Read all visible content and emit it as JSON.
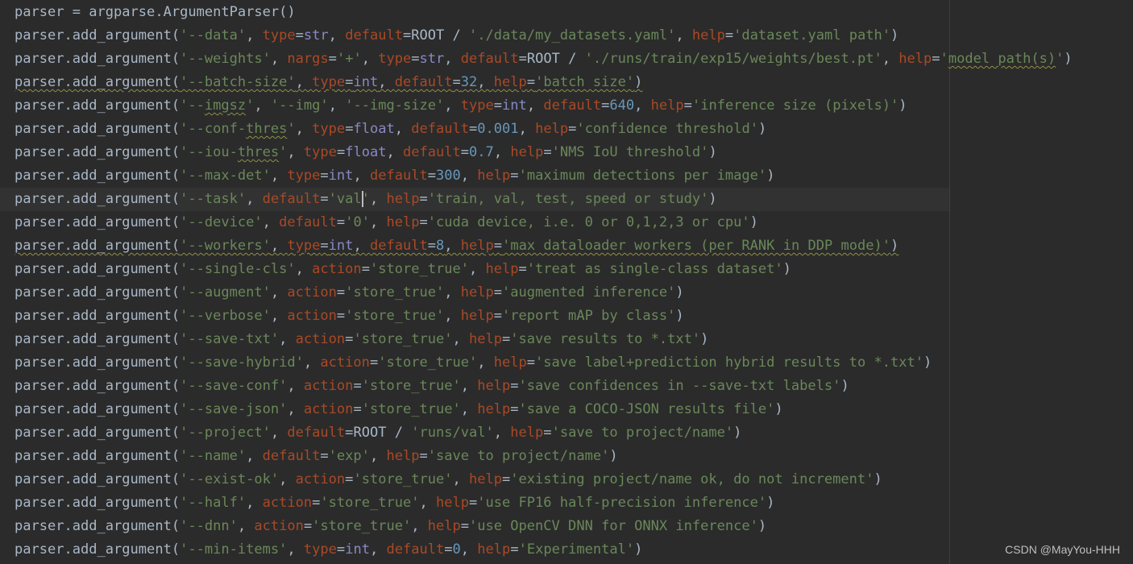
{
  "editor": {
    "caret_line": 8,
    "lines": [
      [
        [
          "id",
          "parser = argparse.ArgumentParser()"
        ]
      ],
      [
        [
          "id",
          "parser.add_argument("
        ],
        [
          "str",
          "'--data'"
        ],
        [
          "op",
          ", "
        ],
        [
          "kw",
          "type"
        ],
        [
          "op",
          "="
        ],
        [
          "builtin",
          "str"
        ],
        [
          "op",
          ", "
        ],
        [
          "kw",
          "default"
        ],
        [
          "op",
          "="
        ],
        [
          "id",
          "ROOT / "
        ],
        [
          "str",
          "'./data/my_datasets.yaml'"
        ],
        [
          "op",
          ", "
        ],
        [
          "kw",
          "help"
        ],
        [
          "op",
          "="
        ],
        [
          "str",
          "'dataset.yaml path'"
        ],
        [
          "op",
          ")"
        ]
      ],
      [
        [
          "id",
          "parser.add_argument("
        ],
        [
          "str",
          "'--weights'"
        ],
        [
          "op",
          ", "
        ],
        [
          "kw",
          "nargs"
        ],
        [
          "op",
          "="
        ],
        [
          "str",
          "'+'"
        ],
        [
          "op",
          ", "
        ],
        [
          "kw",
          "type"
        ],
        [
          "op",
          "="
        ],
        [
          "builtin",
          "str"
        ],
        [
          "op",
          ", "
        ],
        [
          "kw",
          "default"
        ],
        [
          "op",
          "="
        ],
        [
          "id",
          "ROOT / "
        ],
        [
          "str",
          "'./runs/train/exp15/weights/best.pt'"
        ],
        [
          "op",
          ", "
        ],
        [
          "kw",
          "help"
        ],
        [
          "op",
          "="
        ],
        [
          "str",
          "'"
        ],
        [
          "strsq",
          "model path(s)"
        ],
        [
          "str",
          "'"
        ],
        [
          "op",
          ")"
        ]
      ],
      [
        [
          "sq",
          "parser.add_argument("
        ],
        [
          "strsq",
          "'--batch-size'"
        ],
        [
          "opsq",
          ", "
        ],
        [
          "kwsq",
          "type"
        ],
        [
          "opsq",
          "="
        ],
        [
          "builtinsq",
          "int"
        ],
        [
          "opsq",
          ", "
        ],
        [
          "kwsq",
          "default"
        ],
        [
          "opsq",
          "="
        ],
        [
          "numsq",
          "32"
        ],
        [
          "opsq",
          ", "
        ],
        [
          "kwsq",
          "help"
        ],
        [
          "opsq",
          "="
        ],
        [
          "strsq",
          "'batch size'"
        ],
        [
          "opsq",
          ")"
        ]
      ],
      [
        [
          "id",
          "parser.add_argument("
        ],
        [
          "str",
          "'--"
        ],
        [
          "strsq",
          "imgsz"
        ],
        [
          "str",
          "'"
        ],
        [
          "op",
          ", "
        ],
        [
          "str",
          "'--img'"
        ],
        [
          "op",
          ", "
        ],
        [
          "str",
          "'--img-size'"
        ],
        [
          "op",
          ", "
        ],
        [
          "kw",
          "type"
        ],
        [
          "op",
          "="
        ],
        [
          "builtin",
          "int"
        ],
        [
          "op",
          ", "
        ],
        [
          "kw",
          "default"
        ],
        [
          "op",
          "="
        ],
        [
          "num",
          "640"
        ],
        [
          "op",
          ", "
        ],
        [
          "kw",
          "help"
        ],
        [
          "op",
          "="
        ],
        [
          "str",
          "'inference size (pixels)'"
        ],
        [
          "op",
          ")"
        ]
      ],
      [
        [
          "id",
          "parser.add_argument("
        ],
        [
          "str",
          "'--conf-"
        ],
        [
          "strsq",
          "thres"
        ],
        [
          "str",
          "'"
        ],
        [
          "op",
          ", "
        ],
        [
          "kw",
          "type"
        ],
        [
          "op",
          "="
        ],
        [
          "builtin",
          "float"
        ],
        [
          "op",
          ", "
        ],
        [
          "kw",
          "default"
        ],
        [
          "op",
          "="
        ],
        [
          "num",
          "0.001"
        ],
        [
          "op",
          ", "
        ],
        [
          "kw",
          "help"
        ],
        [
          "op",
          "="
        ],
        [
          "str",
          "'confidence threshold'"
        ],
        [
          "op",
          ")"
        ]
      ],
      [
        [
          "id",
          "parser.add_argument("
        ],
        [
          "str",
          "'--iou-"
        ],
        [
          "strsq",
          "thres"
        ],
        [
          "str",
          "'"
        ],
        [
          "op",
          ", "
        ],
        [
          "kw",
          "type"
        ],
        [
          "op",
          "="
        ],
        [
          "builtin",
          "float"
        ],
        [
          "op",
          ", "
        ],
        [
          "kw",
          "default"
        ],
        [
          "op",
          "="
        ],
        [
          "num",
          "0.7"
        ],
        [
          "op",
          ", "
        ],
        [
          "kw",
          "help"
        ],
        [
          "op",
          "="
        ],
        [
          "str",
          "'NMS IoU threshold'"
        ],
        [
          "op",
          ")"
        ]
      ],
      [
        [
          "id",
          "parser.add_argument("
        ],
        [
          "str",
          "'--max-det'"
        ],
        [
          "op",
          ", "
        ],
        [
          "kw",
          "type"
        ],
        [
          "op",
          "="
        ],
        [
          "builtin",
          "int"
        ],
        [
          "op",
          ", "
        ],
        [
          "kw",
          "default"
        ],
        [
          "op",
          "="
        ],
        [
          "num",
          "300"
        ],
        [
          "op",
          ", "
        ],
        [
          "kw",
          "help"
        ],
        [
          "op",
          "="
        ],
        [
          "str",
          "'maximum detections per image'"
        ],
        [
          "op",
          ")"
        ]
      ],
      [
        [
          "id",
          "parser.add_argument("
        ],
        [
          "str",
          "'--task'"
        ],
        [
          "op",
          ", "
        ],
        [
          "kw",
          "default"
        ],
        [
          "op",
          "="
        ],
        [
          "str",
          "'val'"
        ],
        [
          "op",
          ", "
        ],
        [
          "kw",
          "help"
        ],
        [
          "op",
          "="
        ],
        [
          "str",
          "'train, val, test, speed or study'"
        ],
        [
          "op",
          ")"
        ]
      ],
      [
        [
          "id",
          "parser.add_argument("
        ],
        [
          "str",
          "'--device'"
        ],
        [
          "op",
          ", "
        ],
        [
          "kw",
          "default"
        ],
        [
          "op",
          "="
        ],
        [
          "str",
          "'0'"
        ],
        [
          "op",
          ", "
        ],
        [
          "kw",
          "help"
        ],
        [
          "op",
          "="
        ],
        [
          "str",
          "'cuda device, i.e. 0 or 0,1,2,3 or cpu'"
        ],
        [
          "op",
          ")"
        ]
      ],
      [
        [
          "sq",
          "parser.add_argument("
        ],
        [
          "strsq",
          "'--workers'"
        ],
        [
          "opsq",
          ", "
        ],
        [
          "kwsq",
          "type"
        ],
        [
          "opsq",
          "="
        ],
        [
          "builtinsq",
          "int"
        ],
        [
          "opsq",
          ", "
        ],
        [
          "kwsq",
          "default"
        ],
        [
          "opsq",
          "="
        ],
        [
          "numsq",
          "8"
        ],
        [
          "opsq",
          ", "
        ],
        [
          "kwsq",
          "help"
        ],
        [
          "opsq",
          "="
        ],
        [
          "strsq",
          "'max dataloader workers (per RANK in DDP mode)'"
        ],
        [
          "opsq",
          ")"
        ]
      ],
      [
        [
          "id",
          "parser.add_argument("
        ],
        [
          "str",
          "'--single-cls'"
        ],
        [
          "op",
          ", "
        ],
        [
          "kw",
          "action"
        ],
        [
          "op",
          "="
        ],
        [
          "str",
          "'store_true'"
        ],
        [
          "op",
          ", "
        ],
        [
          "kw",
          "help"
        ],
        [
          "op",
          "="
        ],
        [
          "str",
          "'treat as single-class dataset'"
        ],
        [
          "op",
          ")"
        ]
      ],
      [
        [
          "id",
          "parser.add_argument("
        ],
        [
          "str",
          "'--augment'"
        ],
        [
          "op",
          ", "
        ],
        [
          "kw",
          "action"
        ],
        [
          "op",
          "="
        ],
        [
          "str",
          "'store_true'"
        ],
        [
          "op",
          ", "
        ],
        [
          "kw",
          "help"
        ],
        [
          "op",
          "="
        ],
        [
          "str",
          "'augmented inference'"
        ],
        [
          "op",
          ")"
        ]
      ],
      [
        [
          "id",
          "parser.add_argument("
        ],
        [
          "str",
          "'--verbose'"
        ],
        [
          "op",
          ", "
        ],
        [
          "kw",
          "action"
        ],
        [
          "op",
          "="
        ],
        [
          "str",
          "'store_true'"
        ],
        [
          "op",
          ", "
        ],
        [
          "kw",
          "help"
        ],
        [
          "op",
          "="
        ],
        [
          "str",
          "'report mAP by class'"
        ],
        [
          "op",
          ")"
        ]
      ],
      [
        [
          "id",
          "parser.add_argument("
        ],
        [
          "str",
          "'--save-txt'"
        ],
        [
          "op",
          ", "
        ],
        [
          "kw",
          "action"
        ],
        [
          "op",
          "="
        ],
        [
          "str",
          "'store_true'"
        ],
        [
          "op",
          ", "
        ],
        [
          "kw",
          "help"
        ],
        [
          "op",
          "="
        ],
        [
          "str",
          "'save results to *.txt'"
        ],
        [
          "op",
          ")"
        ]
      ],
      [
        [
          "id",
          "parser.add_argument("
        ],
        [
          "str",
          "'--save-hybrid'"
        ],
        [
          "op",
          ", "
        ],
        [
          "kw",
          "action"
        ],
        [
          "op",
          "="
        ],
        [
          "str",
          "'store_true'"
        ],
        [
          "op",
          ", "
        ],
        [
          "kw",
          "help"
        ],
        [
          "op",
          "="
        ],
        [
          "str",
          "'save label+prediction hybrid results to *.txt'"
        ],
        [
          "op",
          ")"
        ]
      ],
      [
        [
          "id",
          "parser.add_argument("
        ],
        [
          "str",
          "'--save-conf'"
        ],
        [
          "op",
          ", "
        ],
        [
          "kw",
          "action"
        ],
        [
          "op",
          "="
        ],
        [
          "str",
          "'store_true'"
        ],
        [
          "op",
          ", "
        ],
        [
          "kw",
          "help"
        ],
        [
          "op",
          "="
        ],
        [
          "str",
          "'save confidences in --save-txt labels'"
        ],
        [
          "op",
          ")"
        ]
      ],
      [
        [
          "id",
          "parser.add_argument("
        ],
        [
          "str",
          "'--save-json'"
        ],
        [
          "op",
          ", "
        ],
        [
          "kw",
          "action"
        ],
        [
          "op",
          "="
        ],
        [
          "str",
          "'store_true'"
        ],
        [
          "op",
          ", "
        ],
        [
          "kw",
          "help"
        ],
        [
          "op",
          "="
        ],
        [
          "str",
          "'save a COCO-JSON results file'"
        ],
        [
          "op",
          ")"
        ]
      ],
      [
        [
          "id",
          "parser.add_argument("
        ],
        [
          "str",
          "'--project'"
        ],
        [
          "op",
          ", "
        ],
        [
          "kw",
          "default"
        ],
        [
          "op",
          "="
        ],
        [
          "id",
          "ROOT / "
        ],
        [
          "str",
          "'runs/val'"
        ],
        [
          "op",
          ", "
        ],
        [
          "kw",
          "help"
        ],
        [
          "op",
          "="
        ],
        [
          "str",
          "'save to project/name'"
        ],
        [
          "op",
          ")"
        ]
      ],
      [
        [
          "id",
          "parser.add_argument("
        ],
        [
          "str",
          "'--name'"
        ],
        [
          "op",
          ", "
        ],
        [
          "kw",
          "default"
        ],
        [
          "op",
          "="
        ],
        [
          "str",
          "'exp'"
        ],
        [
          "op",
          ", "
        ],
        [
          "kw",
          "help"
        ],
        [
          "op",
          "="
        ],
        [
          "str",
          "'save to project/name'"
        ],
        [
          "op",
          ")"
        ]
      ],
      [
        [
          "id",
          "parser.add_argument("
        ],
        [
          "str",
          "'--exist-ok'"
        ],
        [
          "op",
          ", "
        ],
        [
          "kw",
          "action"
        ],
        [
          "op",
          "="
        ],
        [
          "str",
          "'store_true'"
        ],
        [
          "op",
          ", "
        ],
        [
          "kw",
          "help"
        ],
        [
          "op",
          "="
        ],
        [
          "str",
          "'existing project/name ok, do not increment'"
        ],
        [
          "op",
          ")"
        ]
      ],
      [
        [
          "id",
          "parser.add_argument("
        ],
        [
          "str",
          "'--half'"
        ],
        [
          "op",
          ", "
        ],
        [
          "kw",
          "action"
        ],
        [
          "op",
          "="
        ],
        [
          "str",
          "'store_true'"
        ],
        [
          "op",
          ", "
        ],
        [
          "kw",
          "help"
        ],
        [
          "op",
          "="
        ],
        [
          "str",
          "'use FP16 half-precision inference'"
        ],
        [
          "op",
          ")"
        ]
      ],
      [
        [
          "id",
          "parser.add_argument("
        ],
        [
          "str",
          "'--dnn'"
        ],
        [
          "op",
          ", "
        ],
        [
          "kw",
          "action"
        ],
        [
          "op",
          "="
        ],
        [
          "str",
          "'store_true'"
        ],
        [
          "op",
          ", "
        ],
        [
          "kw",
          "help"
        ],
        [
          "op",
          "="
        ],
        [
          "str",
          "'use OpenCV DNN for ONNX inference'"
        ],
        [
          "op",
          ")"
        ]
      ],
      [
        [
          "id",
          "parser.add_argument("
        ],
        [
          "str",
          "'--min-items'"
        ],
        [
          "op",
          ", "
        ],
        [
          "kw",
          "type"
        ],
        [
          "op",
          "="
        ],
        [
          "builtin",
          "int"
        ],
        [
          "op",
          ", "
        ],
        [
          "kw",
          "default"
        ],
        [
          "op",
          "="
        ],
        [
          "num",
          "0"
        ],
        [
          "op",
          ", "
        ],
        [
          "kw",
          "help"
        ],
        [
          "op",
          "="
        ],
        [
          "str",
          "'Experimental'"
        ],
        [
          "op",
          ")"
        ]
      ]
    ]
  },
  "watermark": "CSDN @MayYou-HHH",
  "colors": {
    "background": "#2b2b2b",
    "identifier": "#a9b7c6",
    "string": "#6a8759",
    "keyword_arg": "#aa4926",
    "number": "#6897bb",
    "builtin": "#8888c6"
  }
}
